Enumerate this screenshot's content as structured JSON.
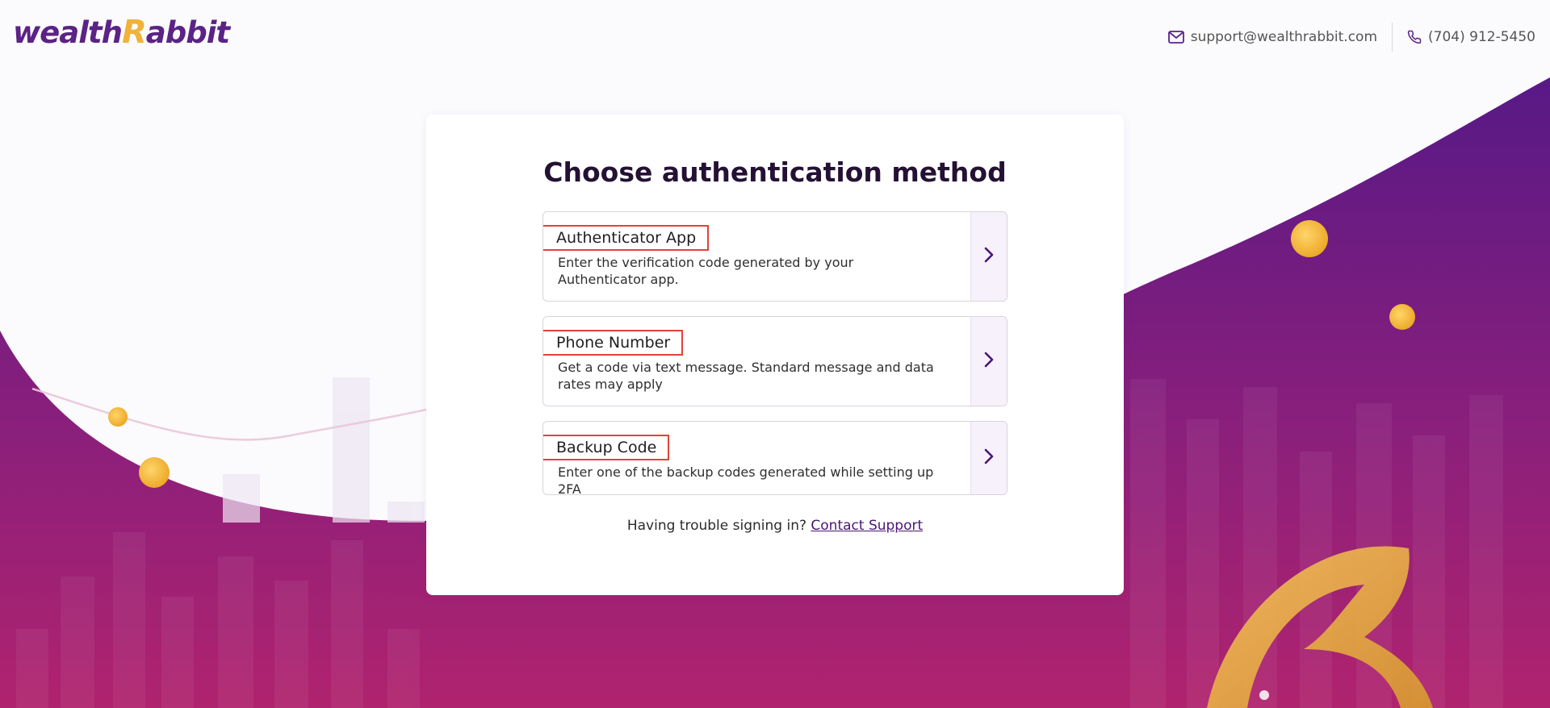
{
  "brand": {
    "logo_text_prefix": "wealth",
    "logo_text_mark": "R",
    "logo_text_suffix": "abbit"
  },
  "header": {
    "email": "support@wealthrabbit.com",
    "phone": "(704) 912-5450",
    "email_icon": "mail-icon",
    "phone_icon": "phone-icon"
  },
  "card": {
    "title": "Choose authentication method",
    "options": [
      {
        "name": "Authenticator App",
        "description": "Enter the verification code generated by your Authenticator app."
      },
      {
        "name": "Phone Number",
        "description": "Get a code via text message. Standard message and data rates may apply"
      },
      {
        "name": "Backup Code",
        "description": "Enter one of the backup codes generated while setting up 2FA"
      }
    ],
    "trouble_text": "Having trouble signing in?",
    "contact_link": "Contact Support"
  },
  "colors": {
    "brand_purple": "#5b2385",
    "brand_gold": "#f0b23c",
    "highlight_red": "#e2423a",
    "bg_gradient_top": "#5a1a86",
    "bg_gradient_bottom": "#b0236e"
  }
}
